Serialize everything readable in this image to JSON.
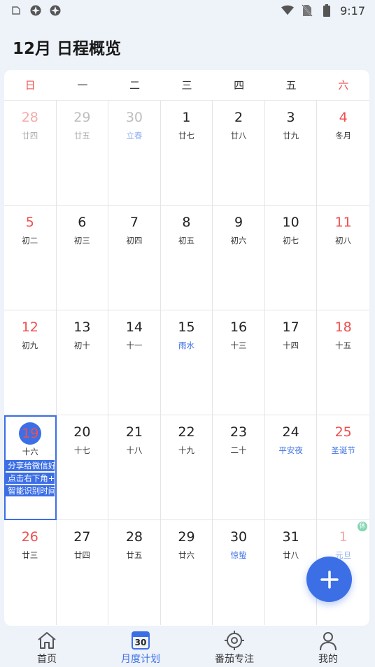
{
  "status_bar": {
    "time": "9:17"
  },
  "header": {
    "title": "12月 日程概览"
  },
  "weekdays": [
    "日",
    "一",
    "二",
    "三",
    "四",
    "五",
    "六"
  ],
  "weeks": [
    [
      {
        "day": "28",
        "sub": "廿四",
        "other": true
      },
      {
        "day": "29",
        "sub": "廿五",
        "other": true
      },
      {
        "day": "30",
        "sub": "立春",
        "other": true,
        "festival": true
      },
      {
        "day": "1",
        "sub": "廿七"
      },
      {
        "day": "2",
        "sub": "廿八"
      },
      {
        "day": "3",
        "sub": "廿九"
      },
      {
        "day": "4",
        "sub": "冬月"
      }
    ],
    [
      {
        "day": "5",
        "sub": "初二"
      },
      {
        "day": "6",
        "sub": "初三"
      },
      {
        "day": "7",
        "sub": "初四"
      },
      {
        "day": "8",
        "sub": "初五"
      },
      {
        "day": "9",
        "sub": "初六"
      },
      {
        "day": "10",
        "sub": "初七"
      },
      {
        "day": "11",
        "sub": "初八"
      }
    ],
    [
      {
        "day": "12",
        "sub": "初九"
      },
      {
        "day": "13",
        "sub": "初十"
      },
      {
        "day": "14",
        "sub": "十一"
      },
      {
        "day": "15",
        "sub": "雨水",
        "festival": true
      },
      {
        "day": "16",
        "sub": "十三"
      },
      {
        "day": "17",
        "sub": "十四"
      },
      {
        "day": "18",
        "sub": "十五"
      }
    ],
    [
      {
        "day": "19",
        "sub": "十六",
        "today": true,
        "events": [
          "分享给微信好",
          "点击右下角+",
          "智能识别时间"
        ]
      },
      {
        "day": "20",
        "sub": "十七"
      },
      {
        "day": "21",
        "sub": "十八"
      },
      {
        "day": "22",
        "sub": "十九"
      },
      {
        "day": "23",
        "sub": "二十"
      },
      {
        "day": "24",
        "sub": "平安夜",
        "festival": true
      },
      {
        "day": "25",
        "sub": "圣诞节",
        "festival": true
      }
    ],
    [
      {
        "day": "26",
        "sub": "廿三"
      },
      {
        "day": "27",
        "sub": "廿四"
      },
      {
        "day": "28",
        "sub": "廿五"
      },
      {
        "day": "29",
        "sub": "廿六"
      },
      {
        "day": "30",
        "sub": "惊蛰",
        "festival": true
      },
      {
        "day": "31",
        "sub": "廿八"
      },
      {
        "day": "1",
        "sub": "元旦",
        "other": true,
        "festival": true,
        "badge": "休"
      }
    ]
  ],
  "nav": [
    {
      "label": "首页",
      "icon": "home-icon"
    },
    {
      "label": "月度计划",
      "icon": "calendar-icon",
      "active": true,
      "icon_text": "30"
    },
    {
      "label": "番茄专注",
      "icon": "target-icon"
    },
    {
      "label": "我的",
      "icon": "person-icon"
    }
  ],
  "colors": {
    "accent": "#3c6fe6",
    "weekend": "#ef4f4f",
    "background": "#eef2f9"
  }
}
